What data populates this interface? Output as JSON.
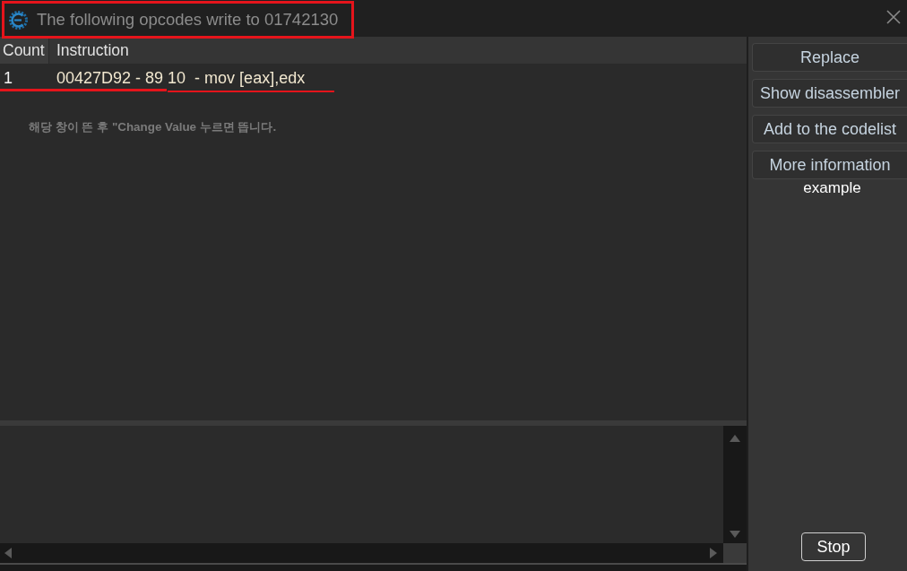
{
  "window": {
    "title": "The following opcodes write to 01742130"
  },
  "table": {
    "columns": [
      "Count",
      "Instruction"
    ],
    "rows": [
      {
        "count": "1",
        "instruction": "00427D92 - 89 10  - mov [eax],edx"
      }
    ]
  },
  "note": "해당 창이 뜬 후 \"Change Value 누르면 뜹니다.",
  "buttons": [
    "Replace",
    "Show disassembler",
    "Add to the codelist",
    "More information"
  ],
  "caption": "example",
  "stop_button": "Stop"
}
